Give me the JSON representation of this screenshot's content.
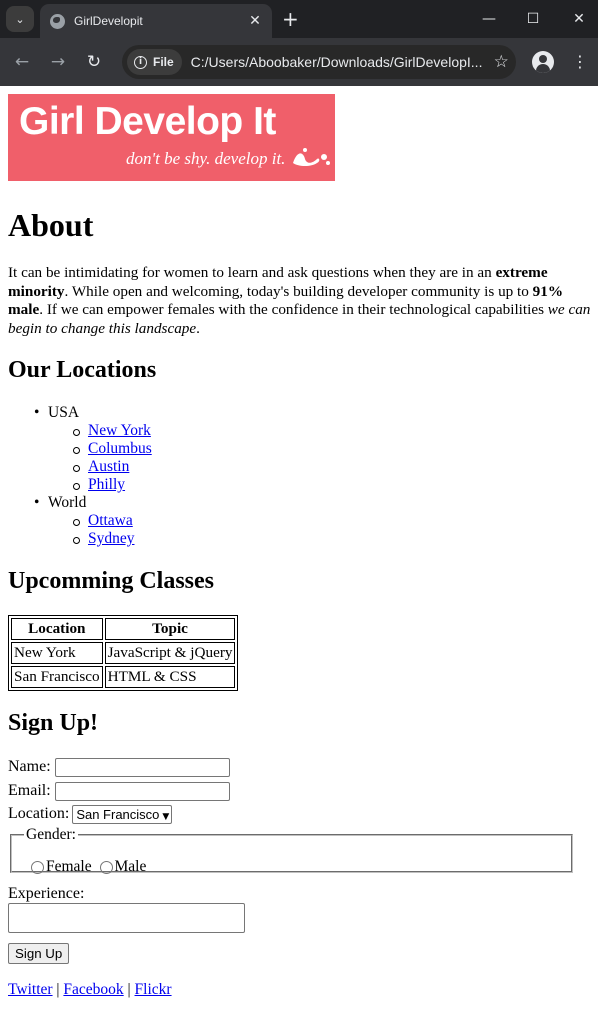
{
  "browser": {
    "tab_title": "GirlDevelopit",
    "omnibox_chip": "File",
    "url": "C:/Users/Aboobaker/Downloads/GirlDevelopI..."
  },
  "logo": {
    "text": "Girl Develop It",
    "tagline": "don't be shy. develop it."
  },
  "about": {
    "heading": "About",
    "p_part1": "It can be intimidating for women to learn and ask questions when they are in an ",
    "p_bold1": "extreme minority",
    "p_part2": ". While open and welcoming, today's building developer community is up to ",
    "p_bold2": "91% male",
    "p_part3": ". If we can empower females with the confidence in their technological capabilities ",
    "p_italic": "we can begin to change this landscape",
    "p_end": "."
  },
  "locations": {
    "heading": "Our Locations",
    "regions": [
      {
        "name": "USA",
        "cities": [
          "New York",
          "Columbus",
          "Austin",
          "Philly"
        ]
      },
      {
        "name": "World",
        "cities": [
          "Ottawa",
          "Sydney"
        ]
      }
    ]
  },
  "classes": {
    "heading": "Upcomming Classes",
    "columns": [
      "Location",
      "Topic"
    ],
    "rows": [
      [
        "New York",
        "JavaScript & jQuery"
      ],
      [
        "San Francisco",
        "HTML & CSS"
      ]
    ]
  },
  "signup": {
    "heading": "Sign Up!",
    "name_label": "Name:",
    "name_value": "",
    "email_label": "Email:",
    "email_value": "",
    "location_label": "Location:",
    "location_selected": "San Francisco",
    "gender_legend": "Gender:",
    "gender_options": [
      "Female",
      "Male"
    ],
    "experience_label": "Experience:",
    "experience_value": "",
    "submit_label": "Sign Up"
  },
  "social": {
    "links": [
      "Twitter",
      "Facebook",
      "Flickr"
    ],
    "separator": "|"
  },
  "colors": {
    "logo_bg": "#f05f6a",
    "link": "#0000ee",
    "chrome_bg": "#202124",
    "toolbar_bg": "#35363a"
  }
}
